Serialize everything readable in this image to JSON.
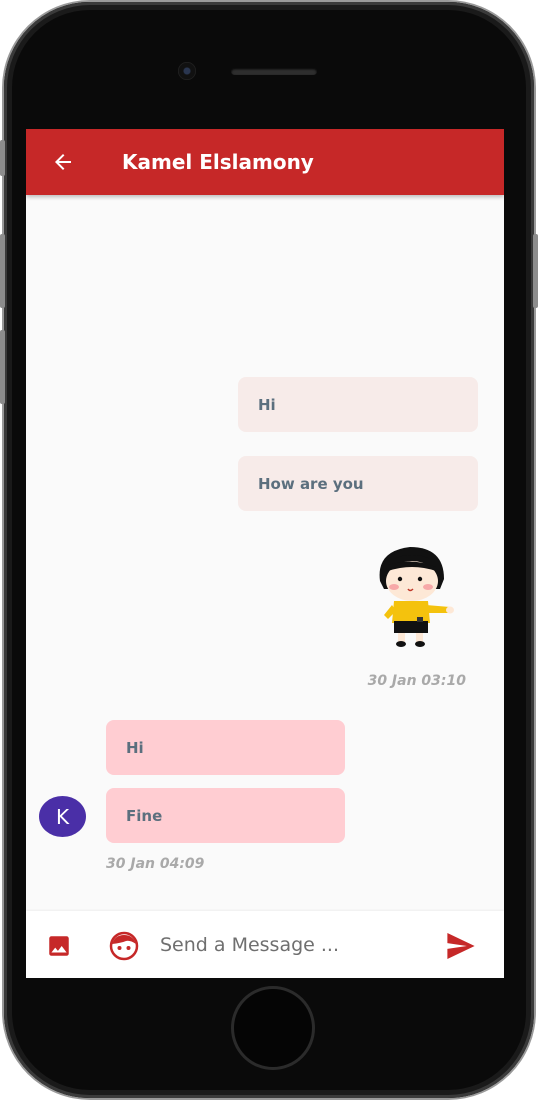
{
  "header": {
    "title": "Kamel Elslamony"
  },
  "messages_outgoing": [
    {
      "text": "Hi"
    },
    {
      "text": "How are you"
    }
  ],
  "outgoing_timestamp": "30 Jan 03:10",
  "messages_incoming": [
    {
      "text": "Hi"
    },
    {
      "text": "Fine"
    }
  ],
  "incoming_timestamp": "30 Jan 04:09",
  "contact_avatar_letter": "K",
  "composer": {
    "placeholder": "Send a Message ..."
  },
  "icons": {
    "back": "arrow-back-icon",
    "gallery": "image-icon",
    "sticker": "sticker-face-icon",
    "send": "send-icon"
  },
  "colors": {
    "appbar": "#c62828",
    "outgoing_bubble": "#f7ebe9",
    "incoming_bubble": "#ffcdd2",
    "avatar": "#4a2fa7",
    "accent": "#c62828"
  }
}
